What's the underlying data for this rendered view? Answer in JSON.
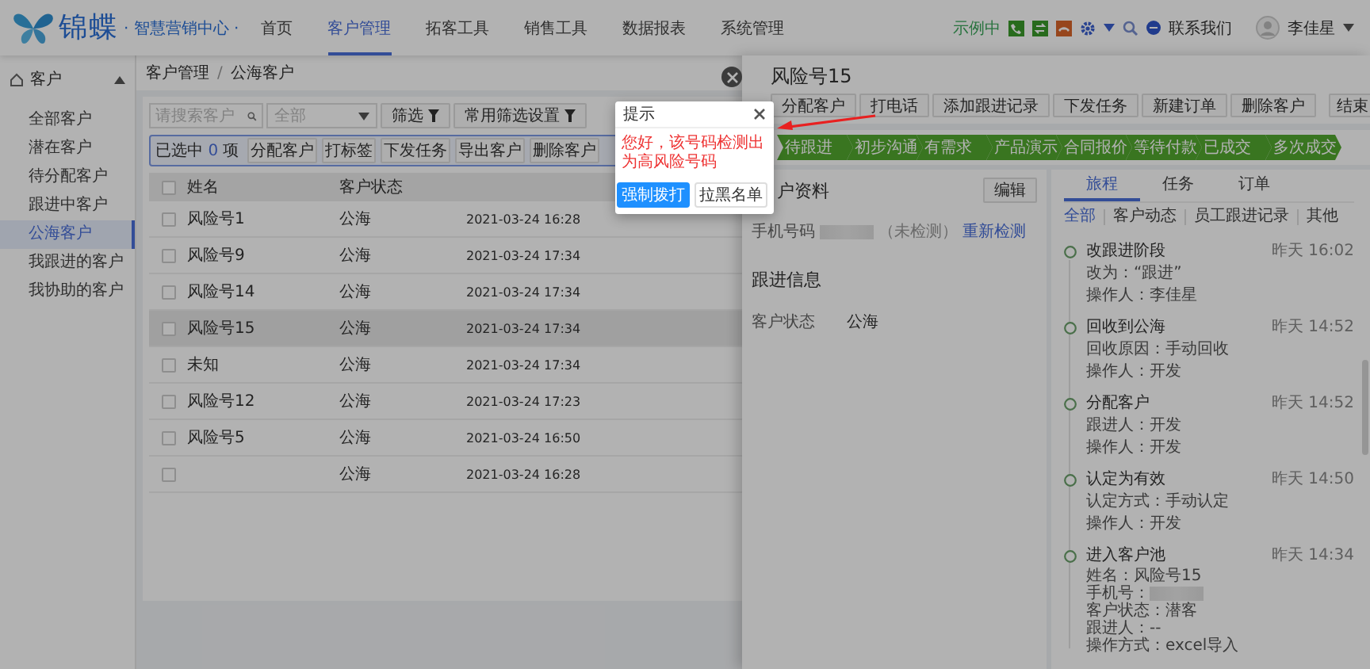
{
  "header": {
    "logo": "锦蝶",
    "subtitle": "· 智慧营销中心 ·",
    "nav": [
      {
        "label": "首页",
        "selected": false
      },
      {
        "label": "客户管理",
        "selected": true
      },
      {
        "label": "拓客工具",
        "selected": false
      },
      {
        "label": "销售工具",
        "selected": false
      },
      {
        "label": "数据报表",
        "selected": false
      },
      {
        "label": "系统管理",
        "selected": false
      }
    ],
    "demo_label": "示例中",
    "contact": "联系我们",
    "user": "李佳星"
  },
  "sidebar": {
    "group": {
      "label": "客户",
      "expanded": true
    },
    "items": [
      {
        "label": "全部客户",
        "selected": false
      },
      {
        "label": "潜在客户",
        "selected": false
      },
      {
        "label": "待分配客户",
        "selected": false
      },
      {
        "label": "跟进中客户",
        "selected": false
      },
      {
        "label": "公海客户",
        "selected": true
      },
      {
        "label": "我跟进的客户",
        "selected": false
      },
      {
        "label": "我协助的客户",
        "selected": false
      }
    ]
  },
  "breadcrumb": {
    "items": [
      "客户管理",
      "公海客户"
    ],
    "separator": "/"
  },
  "filters": {
    "search_placeholder": "请搜索客户",
    "select": "全部",
    "buttons": [
      "筛选",
      "常用筛选设置"
    ]
  },
  "selection": {
    "prefix": "已选中",
    "count": "0",
    "suffix": "项",
    "buttons": [
      "分配客户",
      "打标签",
      "下发任务",
      "导出客户",
      "删除客户"
    ]
  },
  "table": {
    "columns": [
      "姓名",
      "客户状态"
    ],
    "all_checked": false,
    "rows": [
      {
        "name": "风险号1",
        "status": "公海",
        "time": "2021-03-24 16:28",
        "checked": false,
        "selected": false
      },
      {
        "name": "风险号9",
        "status": "公海",
        "time": "2021-03-24 17:34",
        "checked": false,
        "selected": false
      },
      {
        "name": "风险号14",
        "status": "公海",
        "time": "2021-03-24 17:34",
        "checked": false,
        "selected": false
      },
      {
        "name": "风险号15",
        "status": "公海",
        "time": "2021-03-24 17:34",
        "checked": false,
        "selected": true
      },
      {
        "name": "未知",
        "status": "公海",
        "time": "2021-03-24 17:34",
        "checked": false,
        "selected": false
      },
      {
        "name": "风险号12",
        "status": "公海",
        "time": "2021-03-24 17:23",
        "checked": false,
        "selected": false
      },
      {
        "name": "风险号5",
        "status": "公海",
        "time": "2021-03-24 16:50",
        "checked": false,
        "selected": false
      },
      {
        "status": "公海",
        "time": "2021-03-24 16:28",
        "checked": false,
        "selected": false
      }
    ]
  },
  "drawer": {
    "title": "风险号15",
    "actions": [
      "分配客户",
      "打电话",
      "添加跟进记录",
      "下发任务",
      "新建订单",
      "删除客户"
    ],
    "end_button": "结束",
    "stages": [
      {
        "label": "待跟进",
        "done": true
      },
      {
        "label": "初步沟通",
        "done": true
      },
      {
        "label": "有需求",
        "done": true
      },
      {
        "label": "产品演示",
        "done": true
      },
      {
        "label": "合同报价",
        "done": true
      },
      {
        "label": "等待付款",
        "done": true
      },
      {
        "label": "已成交",
        "done": true
      },
      {
        "label": "多次成交",
        "done": true
      }
    ],
    "info_title": "户资料",
    "edit_button": "编辑",
    "phone": {
      "label": "手机号码",
      "masked": true,
      "note": "（未检测）",
      "link": "重新检测"
    },
    "follow_title": "跟进信息",
    "status": {
      "label": "客户状态",
      "value": "公海"
    },
    "tabs": [
      {
        "label": "旅程",
        "selected": true
      },
      {
        "label": "任务",
        "selected": false
      },
      {
        "label": "订单",
        "selected": false
      }
    ],
    "feed_filters": [
      {
        "label": "全部",
        "selected": true
      },
      {
        "label": "客户动态",
        "selected": false
      },
      {
        "label": "员工跟进记录",
        "selected": false
      },
      {
        "label": "其他",
        "selected": false
      }
    ],
    "events": [
      {
        "title": "改跟进阶段",
        "time": "昨天 16:02",
        "dense": false,
        "lines": [
          {
            "text": "改为：“跟进”",
            "masked": false
          },
          {
            "text": "操作人：李佳星",
            "masked": false
          }
        ]
      },
      {
        "title": "回收到公海",
        "time": "昨天 14:52",
        "dense": false,
        "lines": [
          {
            "text": "回收原因：手动回收",
            "masked": false
          },
          {
            "text": "操作人：开发",
            "masked": false
          }
        ]
      },
      {
        "title": "分配客户",
        "time": "昨天 14:52",
        "dense": false,
        "lines": [
          {
            "text": "跟进人：开发",
            "masked": false
          },
          {
            "text": "操作人：开发",
            "masked": false
          }
        ]
      },
      {
        "title": "认定为有效",
        "time": "昨天 14:50",
        "dense": false,
        "lines": [
          {
            "text": "认定方式：手动认定",
            "masked": false
          },
          {
            "text": "操作人：开发",
            "masked": false
          }
        ]
      },
      {
        "title": "进入客户池",
        "time": "昨天 14:34",
        "dense": true,
        "lines": [
          {
            "text": "姓名：风险号15",
            "masked": false
          },
          {
            "text": "手机号：",
            "masked": true
          },
          {
            "text": "客户状态：潜客",
            "masked": false
          },
          {
            "text": "跟进人：--",
            "masked": false
          },
          {
            "text": "操作方式：excel导入",
            "masked": false
          }
        ]
      }
    ]
  },
  "dialog": {
    "title": "提示",
    "message": "您好，该号码检测出为高风险号码",
    "buttons": [
      {
        "label": "强制拨打",
        "primary": true
      },
      {
        "label": "拉黑名单",
        "primary": false
      }
    ]
  }
}
